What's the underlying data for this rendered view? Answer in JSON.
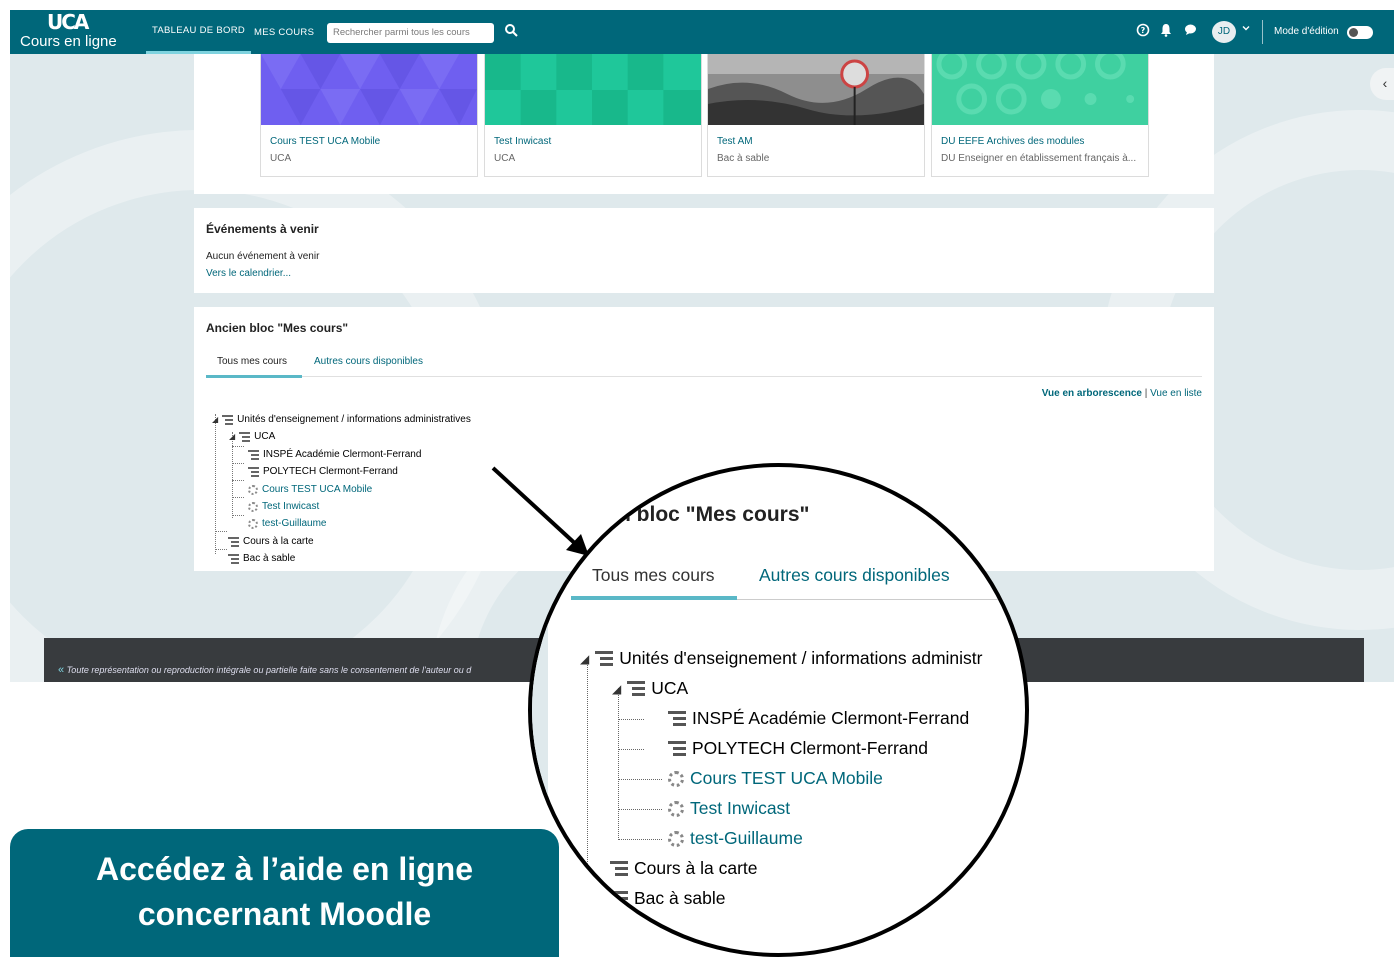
{
  "navbar": {
    "logo_mark": "UCA",
    "logo_text": "Cours en ligne",
    "links": [
      "TABLEAU DE BORD",
      "MES COURS"
    ],
    "search_placeholder": "Rechercher parmi tous les cours",
    "avatar": "JD",
    "edit_mode_label": "Mode d'édition",
    "icons": [
      "search-icon",
      "help-icon",
      "bell-icon",
      "chat-icon",
      "chevron-down-icon"
    ]
  },
  "courses": [
    {
      "title": "Cours TEST UCA Mobile",
      "category": "UCA",
      "color": "#6f5ff0"
    },
    {
      "title": "Test Inwicast",
      "category": "UCA",
      "color": "#1fc79a"
    },
    {
      "title": "Test AM",
      "category": "Bac à sable",
      "color": "#9a9a9a"
    },
    {
      "title": "DU EEFE Archives des modules",
      "category": "DU Enseigner en établissement français à...",
      "color": "#3fd0a0"
    }
  ],
  "events": {
    "title": "Événements à venir",
    "none": "Aucun événement à venir",
    "calendar_link": "Vers le calendrier..."
  },
  "old_block": {
    "title": "Ancien bloc \"Mes cours\"",
    "tabs": [
      "Tous mes cours",
      "Autres cours disponibles"
    ],
    "view_tree": "Vue en arborescence",
    "view_sep": "|",
    "view_list": "Vue en liste",
    "tree": [
      {
        "label": "Unités d'enseignement / informations administratives",
        "type": "category"
      },
      {
        "label": "UCA",
        "type": "category"
      },
      {
        "label": "INSPÉ Académie Clermont-Ferrand",
        "type": "category"
      },
      {
        "label": "POLYTECH Clermont-Ferrand",
        "type": "category"
      },
      {
        "label": "Cours TEST UCA Mobile",
        "type": "course"
      },
      {
        "label": "Test Inwicast",
        "type": "course"
      },
      {
        "label": "test-Guillaume",
        "type": "course"
      },
      {
        "label": "Cours à la carte",
        "type": "category"
      },
      {
        "label": "Bac à sable",
        "type": "category"
      }
    ]
  },
  "footer": {
    "text": "Toute représentation ou reproduction intégrale ou partielle faite sans le consentement de l'auteur ou d"
  },
  "zoom": {
    "title": "n bloc \"Mes cours\"",
    "tab_active": "Tous mes cours",
    "tab_other": "Autres cours disponibles",
    "rows": [
      "Unités d'enseignement / informations administr",
      "UCA",
      "INSPÉ Académie Clermont-Ferrand",
      "POLYTECH Clermont-Ferrand",
      "Cours TEST UCA Mobile",
      "Test Inwicast",
      "test-Guillaume",
      "Cours à la carte",
      "Bac à sable"
    ]
  },
  "cta": {
    "line1": "Accédez à l’aide en ligne",
    "line2": "concernant Moodle"
  },
  "colors": {
    "brand": "#00677a",
    "accent": "#5ab8c7",
    "footer": "#383b3e"
  }
}
